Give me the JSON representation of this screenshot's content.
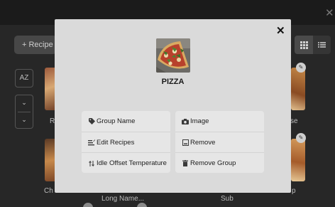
{
  "background": {
    "add_recipe_label": "+ Recipe",
    "sort_label": "AZ",
    "chevron_glyph": "⌄",
    "tile_labels": [
      "R",
      "se",
      "Ch",
      "p"
    ],
    "bottom_labels": [
      "Long Name...",
      "Sub"
    ],
    "close_glyph": "✕"
  },
  "modal": {
    "close_glyph": "✕",
    "image_alt": "pizza-photo",
    "title": "PIZZA",
    "left_actions": [
      {
        "label": "Group Name",
        "icon": "tag-icon"
      },
      {
        "label": "Edit Recipes",
        "icon": "list-edit-icon"
      },
      {
        "label": "Idle Offset Temperature",
        "icon": "temperature-offset-icon"
      }
    ],
    "right_actions": [
      {
        "label": "Image",
        "icon": "camera-icon"
      },
      {
        "label": "Remove",
        "icon": "remove-image-icon"
      },
      {
        "label": "Remove Group",
        "icon": "trash-icon"
      }
    ]
  },
  "colors": {
    "overlay": "#0b0b0b",
    "modal_bg": "#dadada",
    "panel_bg": "#e6e6e6",
    "text": "#202020"
  }
}
